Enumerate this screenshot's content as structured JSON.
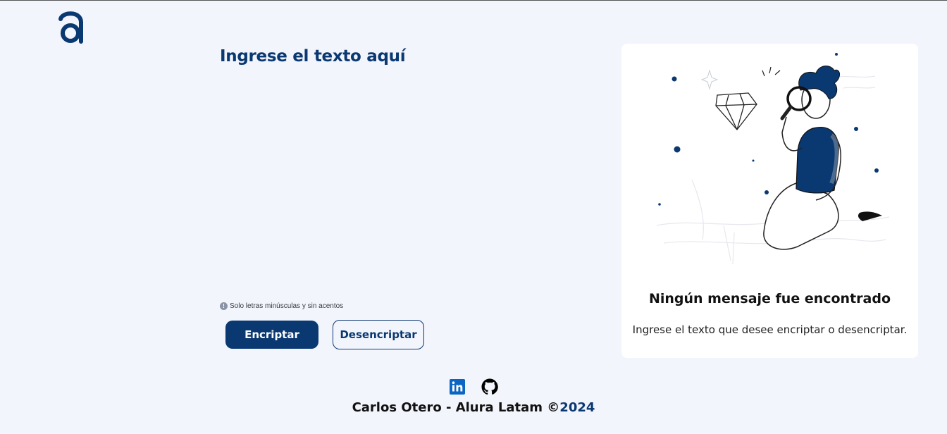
{
  "brand": {
    "logo_icon": "alura-logo-icon",
    "color": "#0a3871"
  },
  "input": {
    "title": "Ingrese el texto aquí",
    "value": "",
    "placeholder": ""
  },
  "hint": {
    "icon": "info-icon",
    "glyph": "!",
    "text": "Solo letras minúsculas y sin acentos"
  },
  "buttons": {
    "encrypt": "Encriptar",
    "decrypt": "Desencriptar"
  },
  "output": {
    "illustration": "person-with-magnifier-illustration",
    "title": "Ningún mensaje fue encontrado",
    "subtitle": "Ingrese el texto que desee encriptar o desencriptar."
  },
  "social": [
    {
      "icon": "linkedin-icon",
      "color": "#0a66c2"
    },
    {
      "icon": "github-icon",
      "color": "#000000"
    }
  ],
  "footer": {
    "text": "Carlos Otero - Alura Latam ©",
    "year": "2024"
  }
}
